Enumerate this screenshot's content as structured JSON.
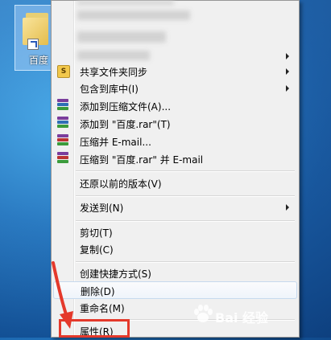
{
  "desktop": {
    "icon_label": "百度"
  },
  "menu": {
    "items": [
      {
        "label": "共享文件夹同步",
        "has_submenu": true
      },
      {
        "label": "包含到库中(I)",
        "has_submenu": true
      },
      {
        "label": "添加到压缩文件(A)..."
      },
      {
        "label": "添加到 \"百度.rar\"(T)"
      },
      {
        "label": "压缩并 E-mail..."
      },
      {
        "label": "压缩到 \"百度.rar\" 并 E-mail"
      },
      {
        "label": "还原以前的版本(V)"
      },
      {
        "label": "发送到(N)",
        "has_submenu": true
      },
      {
        "label": "剪切(T)"
      },
      {
        "label": "复制(C)"
      },
      {
        "label": "创建快捷方式(S)"
      },
      {
        "label": "删除(D)"
      },
      {
        "label": "重命名(M)"
      },
      {
        "label": "属性(R)"
      }
    ]
  },
  "watermark": {
    "text": "Bai 经验"
  },
  "colors": {
    "highlight_box": "#e4392b",
    "menu_bg": "#f0f0f0"
  }
}
